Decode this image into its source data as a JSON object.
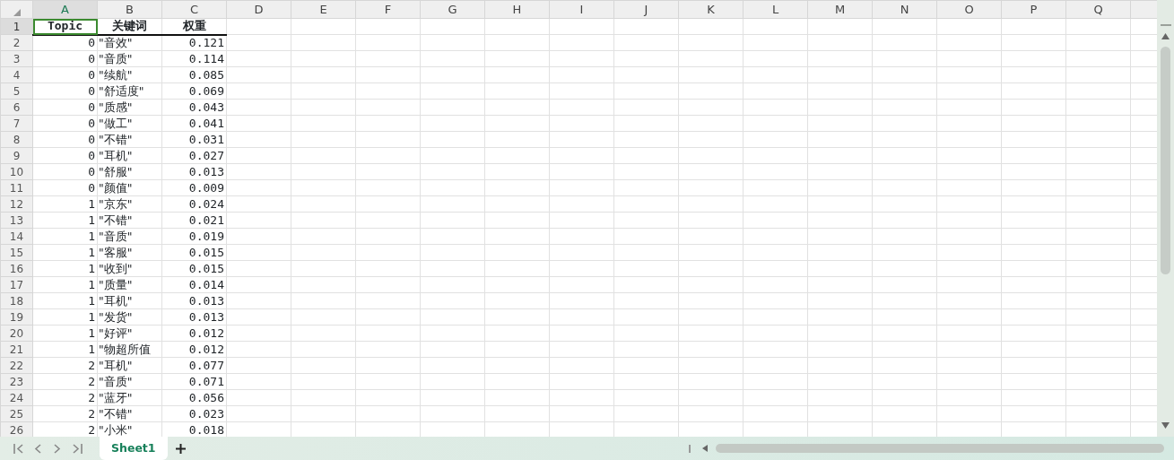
{
  "column_headers": [
    {
      "label": "A",
      "selected": true
    },
    {
      "label": "B",
      "selected": false
    },
    {
      "label": "C",
      "selected": false
    },
    {
      "label": "D",
      "selected": false
    },
    {
      "label": "E",
      "selected": false
    },
    {
      "label": "F",
      "selected": false
    },
    {
      "label": "G",
      "selected": false
    },
    {
      "label": "H",
      "selected": false
    },
    {
      "label": "I",
      "selected": false
    },
    {
      "label": "J",
      "selected": false
    },
    {
      "label": "K",
      "selected": false
    },
    {
      "label": "L",
      "selected": false
    },
    {
      "label": "M",
      "selected": false
    },
    {
      "label": "N",
      "selected": false
    },
    {
      "label": "O",
      "selected": false
    },
    {
      "label": "P",
      "selected": false
    },
    {
      "label": "Q",
      "selected": false
    }
  ],
  "header_row": {
    "number": "1",
    "number_selected": true,
    "cells": [
      {
        "text": "Topic",
        "selected": true
      },
      {
        "text": "关键词",
        "selected": false
      },
      {
        "text": "权重",
        "selected": false
      }
    ]
  },
  "rows": [
    {
      "number": "2",
      "topic": "0",
      "keyword": "\"音效\"",
      "weight": "0.121"
    },
    {
      "number": "3",
      "topic": "0",
      "keyword": "\"音质\"",
      "weight": "0.114"
    },
    {
      "number": "4",
      "topic": "0",
      "keyword": "\"续航\"",
      "weight": "0.085"
    },
    {
      "number": "5",
      "topic": "0",
      "keyword": "\"舒适度\"",
      "weight": "0.069"
    },
    {
      "number": "6",
      "topic": "0",
      "keyword": "\"质感\"",
      "weight": "0.043"
    },
    {
      "number": "7",
      "topic": "0",
      "keyword": "\"做工\"",
      "weight": "0.041"
    },
    {
      "number": "8",
      "topic": "0",
      "keyword": "\"不错\"",
      "weight": "0.031"
    },
    {
      "number": "9",
      "topic": "0",
      "keyword": "\"耳机\"",
      "weight": "0.027"
    },
    {
      "number": "10",
      "topic": "0",
      "keyword": "\"舒服\"",
      "weight": "0.013"
    },
    {
      "number": "11",
      "topic": "0",
      "keyword": "\"颜值\"",
      "weight": "0.009"
    },
    {
      "number": "12",
      "topic": "1",
      "keyword": "\"京东\"",
      "weight": "0.024"
    },
    {
      "number": "13",
      "topic": "1",
      "keyword": "\"不错\"",
      "weight": "0.021"
    },
    {
      "number": "14",
      "topic": "1",
      "keyword": "\"音质\"",
      "weight": "0.019"
    },
    {
      "number": "15",
      "topic": "1",
      "keyword": "\"客服\"",
      "weight": "0.015"
    },
    {
      "number": "16",
      "topic": "1",
      "keyword": "\"收到\"",
      "weight": "0.015"
    },
    {
      "number": "17",
      "topic": "1",
      "keyword": "\"质量\"",
      "weight": "0.014"
    },
    {
      "number": "18",
      "topic": "1",
      "keyword": "\"耳机\"",
      "weight": "0.013"
    },
    {
      "number": "19",
      "topic": "1",
      "keyword": "\"发货\"",
      "weight": "0.013"
    },
    {
      "number": "20",
      "topic": "1",
      "keyword": "\"好评\"",
      "weight": "0.012"
    },
    {
      "number": "21",
      "topic": "1",
      "keyword": "\"物超所值",
      "weight": "0.012"
    },
    {
      "number": "22",
      "topic": "2",
      "keyword": "\"耳机\"",
      "weight": "0.077"
    },
    {
      "number": "23",
      "topic": "2",
      "keyword": "\"音质\"",
      "weight": "0.071"
    },
    {
      "number": "24",
      "topic": "2",
      "keyword": "\"蓝牙\"",
      "weight": "0.056"
    },
    {
      "number": "25",
      "topic": "2",
      "keyword": "\"不错\"",
      "weight": "0.023"
    },
    {
      "number": "26",
      "topic": "2",
      "keyword": "\"小米\"",
      "weight": "0.018"
    }
  ],
  "sheet_tabs": [
    {
      "label": "Sheet1",
      "selected": true
    }
  ]
}
